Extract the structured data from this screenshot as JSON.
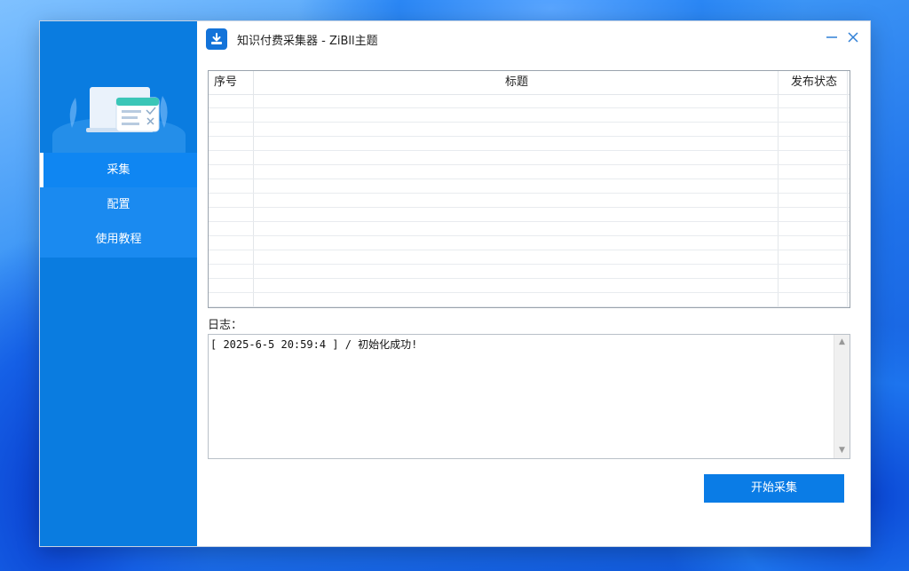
{
  "window": {
    "title": "知识付费采集器 - ZiBll主题",
    "minimize_glyph": "—",
    "close_glyph": "✕"
  },
  "sidebar": {
    "items": [
      {
        "label": "采集",
        "active": true
      },
      {
        "label": "配置",
        "active": false
      },
      {
        "label": "使用教程",
        "active": false
      }
    ]
  },
  "table": {
    "columns": [
      "序号",
      "标题",
      "发布状态"
    ],
    "rows": []
  },
  "log": {
    "label": "日志：",
    "lines": [
      "[ 2025-6-5 20:59:4 ] / 初始化成功!"
    ]
  },
  "actions": {
    "start_label": "开始采集"
  },
  "colors": {
    "accent": "#0a7ce6",
    "sidebar": "#0a7ce0"
  }
}
